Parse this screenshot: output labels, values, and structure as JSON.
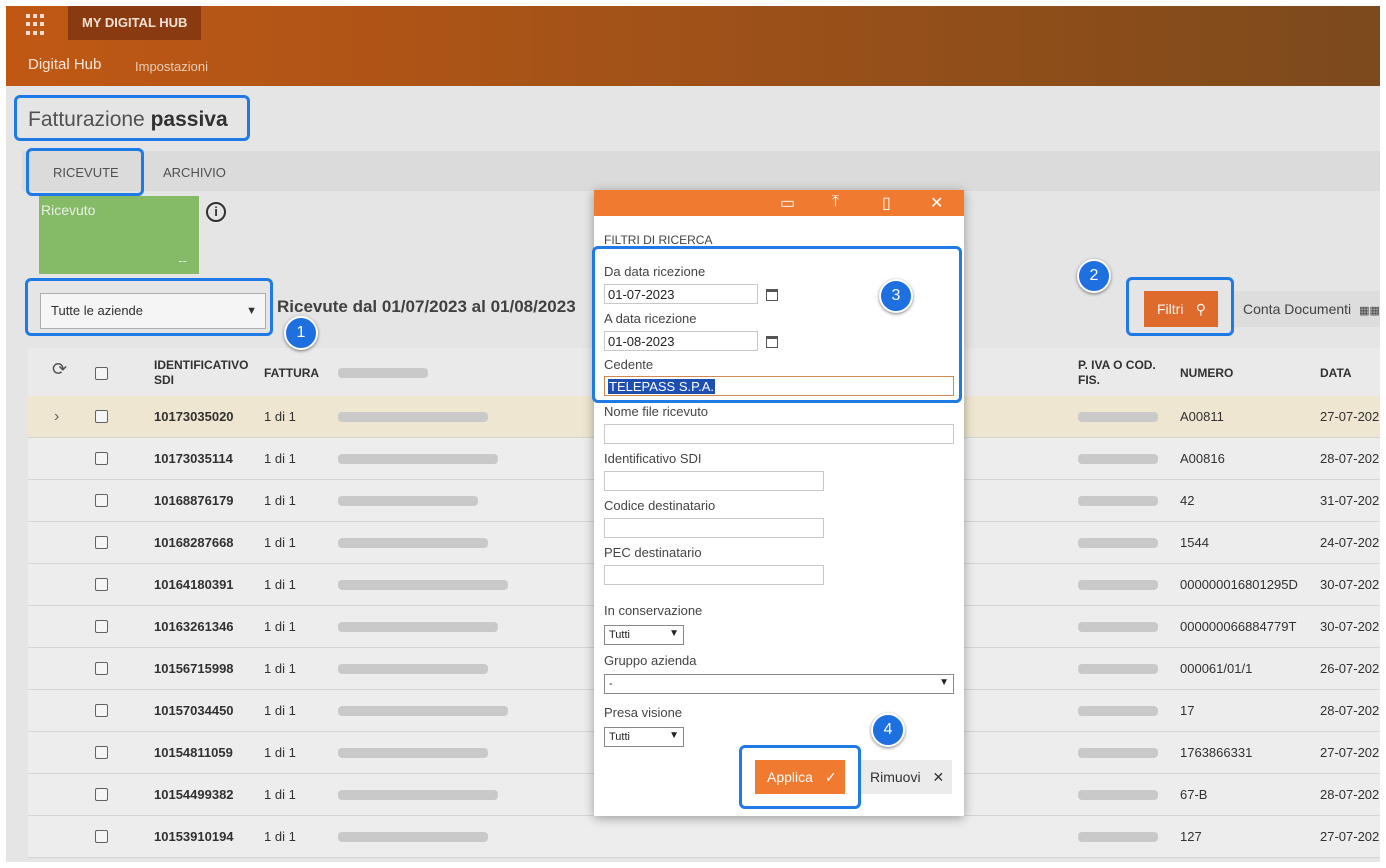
{
  "header": {
    "brand": "MY DIGITAL HUB",
    "app_name": "Digital Hub",
    "settings": "Impostazioni"
  },
  "page": {
    "title_light": "Fatturazione",
    "title_bold": "passiva"
  },
  "tabs": [
    {
      "label": "RICEVUTE"
    },
    {
      "label": "ARCHIVIO"
    }
  ],
  "tile": {
    "label": "Ricevuto",
    "value": "--"
  },
  "toolbar": {
    "company_select": "Tutte le aziende",
    "period": "Ricevute dal 01/07/2023 al 01/08/2023",
    "filtri_label": "Filtri",
    "conta_label": "Conta Documenti"
  },
  "table": {
    "headers": {
      "id": "IDENTIFICATIVO SDI",
      "fattura": "FATTURA",
      "piva": "P. IVA O COD. FIS.",
      "numero": "NUMERO",
      "data": "DATA"
    },
    "rows": [
      {
        "id": "10173035020",
        "fattura": "1 di 1",
        "numero": "A00811",
        "data": "27-07-202"
      },
      {
        "id": "10173035114",
        "fattura": "1 di 1",
        "numero": "A00816",
        "data": "28-07-202"
      },
      {
        "id": "10168876179",
        "fattura": "1 di 1",
        "numero": "42",
        "data": "31-07-202"
      },
      {
        "id": "10168287668",
        "fattura": "1 di 1",
        "numero": "1544",
        "data": "24-07-202"
      },
      {
        "id": "10164180391",
        "fattura": "1 di 1",
        "numero": "000000016801295D",
        "data": "30-07-202"
      },
      {
        "id": "10163261346",
        "fattura": "1 di 1",
        "numero": "000000066884779T",
        "data": "30-07-202"
      },
      {
        "id": "10156715998",
        "fattura": "1 di 1",
        "numero": "000061/01/1",
        "data": "26-07-202"
      },
      {
        "id": "10157034450",
        "fattura": "1 di 1",
        "numero": "17",
        "data": "28-07-202"
      },
      {
        "id": "10154811059",
        "fattura": "1 di 1",
        "numero": "1763866331",
        "data": "27-07-202"
      },
      {
        "id": "10154499382",
        "fattura": "1 di 1",
        "numero": "67-B",
        "data": "28-07-202"
      },
      {
        "id": "10153910194",
        "fattura": "1 di 1",
        "numero": "127",
        "data": "27-07-202"
      }
    ]
  },
  "modal": {
    "section_title": "FILTRI DI RICERCA",
    "da_data_label": "Da data ricezione",
    "da_data_value": "01-07-2023",
    "a_data_label": "A data ricezione",
    "a_data_value": "01-08-2023",
    "cedente_label": "Cedente",
    "cedente_value": "TELEPASS S.P.A.",
    "nome_file_label": "Nome file ricevuto",
    "id_sdi_label": "Identificativo SDI",
    "codice_dest_label": "Codice destinatario",
    "pec_dest_label": "PEC destinatario",
    "conservazione_label": "In conservazione",
    "conservazione_value": "Tutti",
    "gruppo_label": "Gruppo azienda",
    "gruppo_value": "-",
    "presa_label": "Presa visione",
    "presa_value": "Tutti",
    "applica_label": "Applica",
    "rimuovi_label": "Rimuovi"
  },
  "badges": [
    "1",
    "2",
    "3",
    "4"
  ],
  "colors": {
    "accent": "#ef7a30",
    "annotation": "#1f7ae6"
  }
}
